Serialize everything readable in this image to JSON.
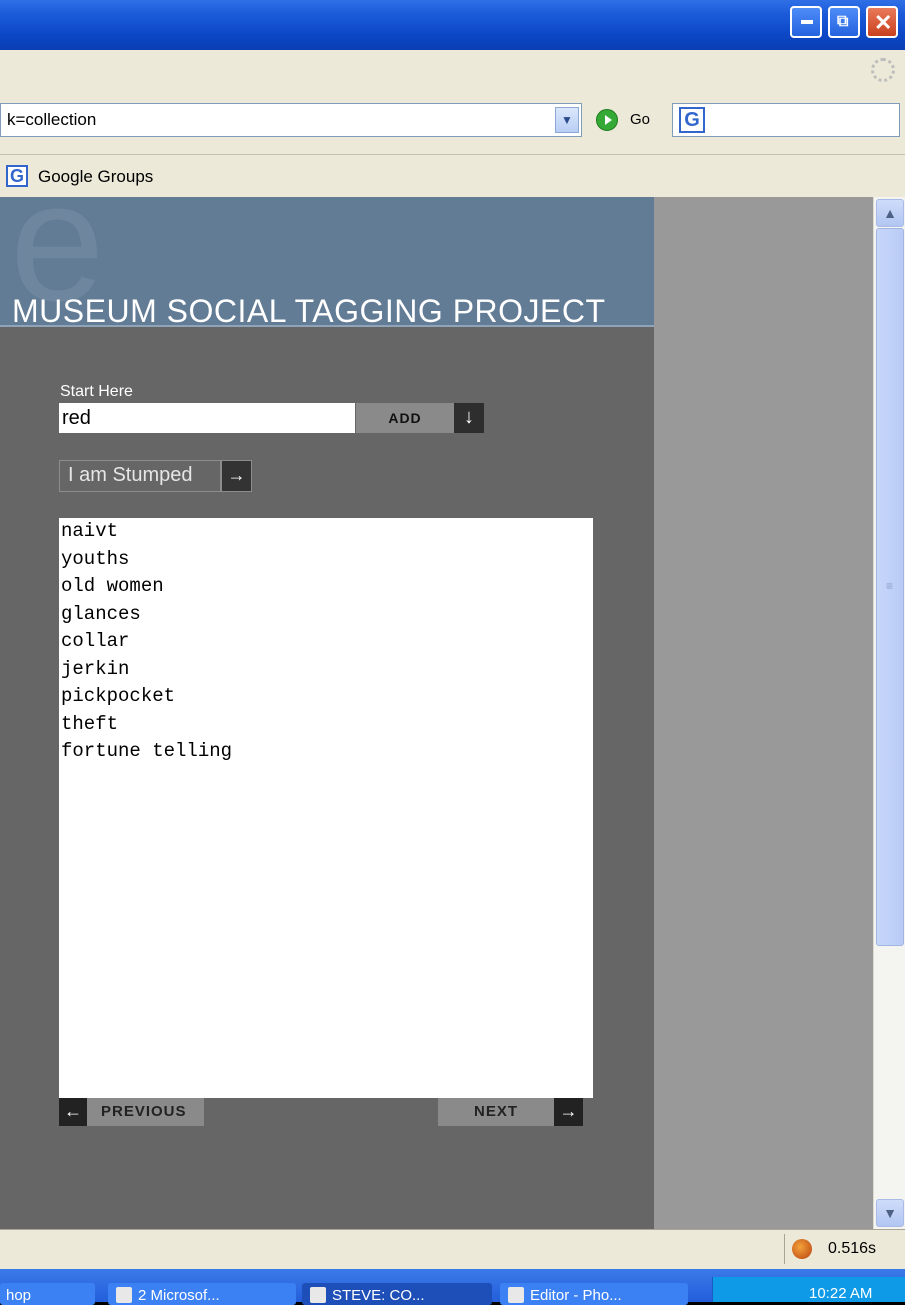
{
  "browser": {
    "address": "k=collection",
    "go_label": "Go",
    "links": [
      "Google Groups"
    ],
    "status_time": "0.516s"
  },
  "page": {
    "logo_letter": "e",
    "title": "MUSEUM SOCIAL TAGGING PROJECT",
    "start_label": "Start Here",
    "tag_input_value": "red",
    "add_label": "ADD",
    "stumped_label": "I am Stumped",
    "tags": [
      "naivt",
      "youths",
      "old women",
      "glances",
      "collar",
      "jerkin",
      "pickpocket",
      "theft",
      "fortune telling"
    ],
    "prev_label": "PREVIOUS",
    "next_label": "NEXT"
  },
  "taskbar": {
    "buttons": [
      "hop",
      "2 Microsof...",
      "STEVE: CO...",
      "Editor - Pho..."
    ],
    "clock": "10:22 AM"
  },
  "colors": {
    "header_bg": "#627c95",
    "page_bg": "#666666",
    "outer_bg": "#999999"
  },
  "icons": {
    "go": "go-arrow-icon",
    "add": "down-arrow-icon",
    "stumped": "right-arrow-icon",
    "prev": "left-arrow-icon",
    "next": "right-arrow-icon"
  }
}
